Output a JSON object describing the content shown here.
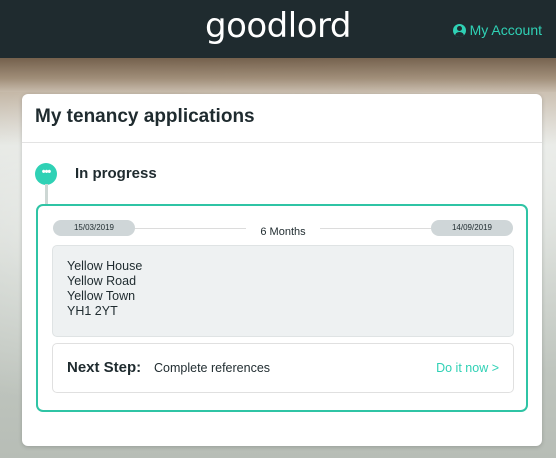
{
  "header": {
    "logo_text": "goodlord",
    "account_label": "My Account",
    "account_icon": "user-circle-icon",
    "background_color": "#1f2b2f",
    "accent_color": "#2fd1b5"
  },
  "main": {
    "title": "My tenancy applications",
    "status": {
      "icon": "ellipsis-icon",
      "icon_text": "•••",
      "label": "In progress"
    },
    "application": {
      "start_date": "15/03/2019",
      "duration": "6 Months",
      "end_date": "14/09/2019",
      "address": {
        "line1": "Yellow House",
        "line2": "Yellow Road",
        "line3": "Yellow Town",
        "postcode": "YH1 2YT"
      },
      "next_step": {
        "label": "Next Step:",
        "description": "Complete references",
        "action_label": "Do it now >"
      }
    }
  }
}
